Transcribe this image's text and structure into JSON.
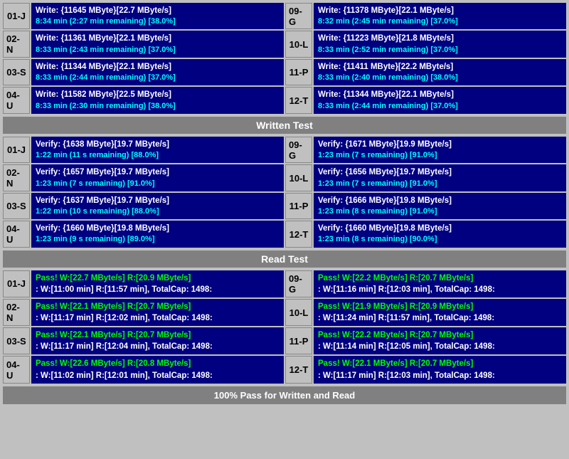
{
  "writeSection": {
    "rows": [
      {
        "left": {
          "id": "01-J",
          "line1": "Write: {11645 MByte}[22.7 MByte/s]",
          "line2": "8:34 min (2:27 min remaining)  [38.0%]"
        },
        "right": {
          "id": "09-G",
          "line1": "Write: {11378 MByte}[22.1 MByte/s]",
          "line2": "8:32 min (2:45 min remaining)  [37.0%]"
        }
      },
      {
        "left": {
          "id": "02-N",
          "line1": "Write: {11361 MByte}[22.1 MByte/s]",
          "line2": "8:33 min (2:43 min remaining)  [37.0%]"
        },
        "right": {
          "id": "10-L",
          "line1": "Write: {11223 MByte}[21.8 MByte/s]",
          "line2": "8:33 min (2:52 min remaining)  [37.0%]"
        }
      },
      {
        "left": {
          "id": "03-S",
          "line1": "Write: {11344 MByte}[22.1 MByte/s]",
          "line2": "8:33 min (2:44 min remaining)  [37.0%]"
        },
        "right": {
          "id": "11-P",
          "line1": "Write: {11411 MByte}[22.2 MByte/s]",
          "line2": "8:33 min (2:40 min remaining)  [38.0%]"
        }
      },
      {
        "left": {
          "id": "04-U",
          "line1": "Write: {11582 MByte}[22.5 MByte/s]",
          "line2": "8:33 min (2:30 min remaining)  [38.0%]"
        },
        "right": {
          "id": "12-T",
          "line1": "Write: {11344 MByte}[22.1 MByte/s]",
          "line2": "8:33 min (2:44 min remaining)  [37.0%]"
        }
      }
    ],
    "title": "Written Test"
  },
  "verifySection": {
    "rows": [
      {
        "left": {
          "id": "01-J",
          "line1": "Verify: {1638 MByte}[19.7 MByte/s]",
          "line2": "1:22 min (11 s remaining)   [88.0%]"
        },
        "right": {
          "id": "09-G",
          "line1": "Verify: {1671 MByte}[19.9 MByte/s]",
          "line2": "1:23 min (7 s remaining)   [91.0%]"
        }
      },
      {
        "left": {
          "id": "02-N",
          "line1": "Verify: {1657 MByte}[19.7 MByte/s]",
          "line2": "1:23 min (7 s remaining)   [91.0%]"
        },
        "right": {
          "id": "10-L",
          "line1": "Verify: {1656 MByte}[19.7 MByte/s]",
          "line2": "1:23 min (7 s remaining)   [91.0%]"
        }
      },
      {
        "left": {
          "id": "03-S",
          "line1": "Verify: {1637 MByte}[19.7 MByte/s]",
          "line2": "1:22 min (10 s remaining)   [88.0%]"
        },
        "right": {
          "id": "11-P",
          "line1": "Verify: {1666 MByte}[19.8 MByte/s]",
          "line2": "1:23 min (8 s remaining)   [91.0%]"
        }
      },
      {
        "left": {
          "id": "04-U",
          "line1": "Verify: {1660 MByte}[19.8 MByte/s]",
          "line2": "1:23 min (9 s remaining)   [89.0%]"
        },
        "right": {
          "id": "12-T",
          "line1": "Verify: {1660 MByte}[19.8 MByte/s]",
          "line2": "1:23 min (8 s remaining)   [90.0%]"
        }
      }
    ],
    "title": "Read Test"
  },
  "passSection": {
    "rows": [
      {
        "left": {
          "id": "01-J",
          "line1": "Pass! W:[22.7 MByte/s] R:[20.9 MByte/s]",
          "line2": ": W:[11:00 min] R:[11:57 min], TotalCap: 1498:"
        },
        "right": {
          "id": "09-G",
          "line1": "Pass! W:[22.2 MByte/s] R:[20.7 MByte/s]",
          "line2": ": W:[11:16 min] R:[12:03 min], TotalCap: 1498:"
        }
      },
      {
        "left": {
          "id": "02-N",
          "line1": "Pass! W:[22.1 MByte/s] R:[20.7 MByte/s]",
          "line2": ": W:[11:17 min] R:[12:02 min], TotalCap: 1498:"
        },
        "right": {
          "id": "10-L",
          "line1": "Pass! W:[21.9 MByte/s] R:[20.9 MByte/s]",
          "line2": ": W:[11:24 min] R:[11:57 min], TotalCap: 1498:"
        }
      },
      {
        "left": {
          "id": "03-S",
          "line1": "Pass! W:[22.1 MByte/s] R:[20.7 MByte/s]",
          "line2": ": W:[11:17 min] R:[12:04 min], TotalCap: 1498:"
        },
        "right": {
          "id": "11-P",
          "line1": "Pass! W:[22.2 MByte/s] R:[20.7 MByte/s]",
          "line2": ": W:[11:14 min] R:[12:05 min], TotalCap: 1498:"
        }
      },
      {
        "left": {
          "id": "04-U",
          "line1": "Pass! W:[22.6 MByte/s] R:[20.8 MByte/s]",
          "line2": ": W:[11:02 min] R:[12:01 min], TotalCap: 1498:"
        },
        "right": {
          "id": "12-T",
          "line1": "Pass! W:[22.1 MByte/s] R:[20.7 MByte/s]",
          "line2": ": W:[11:17 min] R:[12:03 min], TotalCap: 1498:"
        }
      }
    ],
    "title": "Read Test",
    "footer": "100% Pass for Written and Read"
  }
}
